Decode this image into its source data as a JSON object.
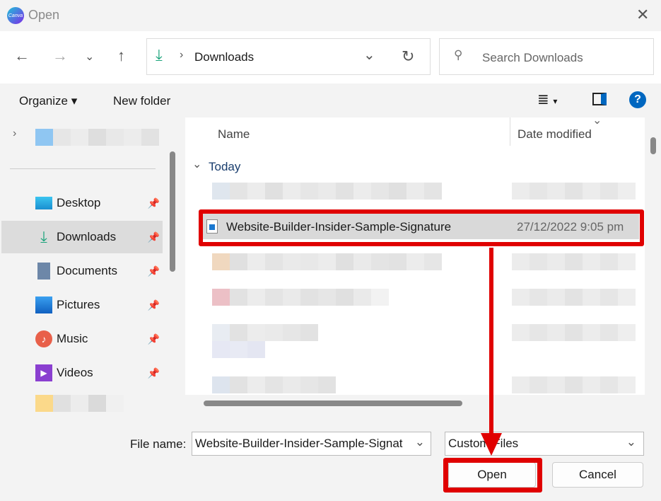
{
  "window": {
    "title": "Open",
    "logo_text": "Canva"
  },
  "nav": {
    "address": "Downloads",
    "search_placeholder": "Search Downloads"
  },
  "toolbar": {
    "organize": "Organize",
    "new_folder": "New folder",
    "help": "?"
  },
  "sidebar": {
    "items": [
      {
        "label": "Desktop",
        "icon": "desktop-icon"
      },
      {
        "label": "Downloads",
        "icon": "download-icon"
      },
      {
        "label": "Documents",
        "icon": "documents-icon"
      },
      {
        "label": "Pictures",
        "icon": "pictures-icon"
      },
      {
        "label": "Music",
        "icon": "music-icon"
      },
      {
        "label": "Videos",
        "icon": "videos-icon"
      }
    ]
  },
  "list": {
    "columns": {
      "name": "Name",
      "date": "Date modified"
    },
    "group": "Today",
    "selected": {
      "name": "Website-Builder-Insider-Sample-Signature",
      "date": "27/12/2022 9:05 pm"
    }
  },
  "footer": {
    "file_name_label": "File name:",
    "file_name_value": "Website-Builder-Insider-Sample-Signat",
    "file_type": "Custom Files",
    "open": "Open",
    "cancel": "Cancel"
  },
  "colors": {
    "annotation": "#e00000",
    "accent": "#0067c0"
  }
}
